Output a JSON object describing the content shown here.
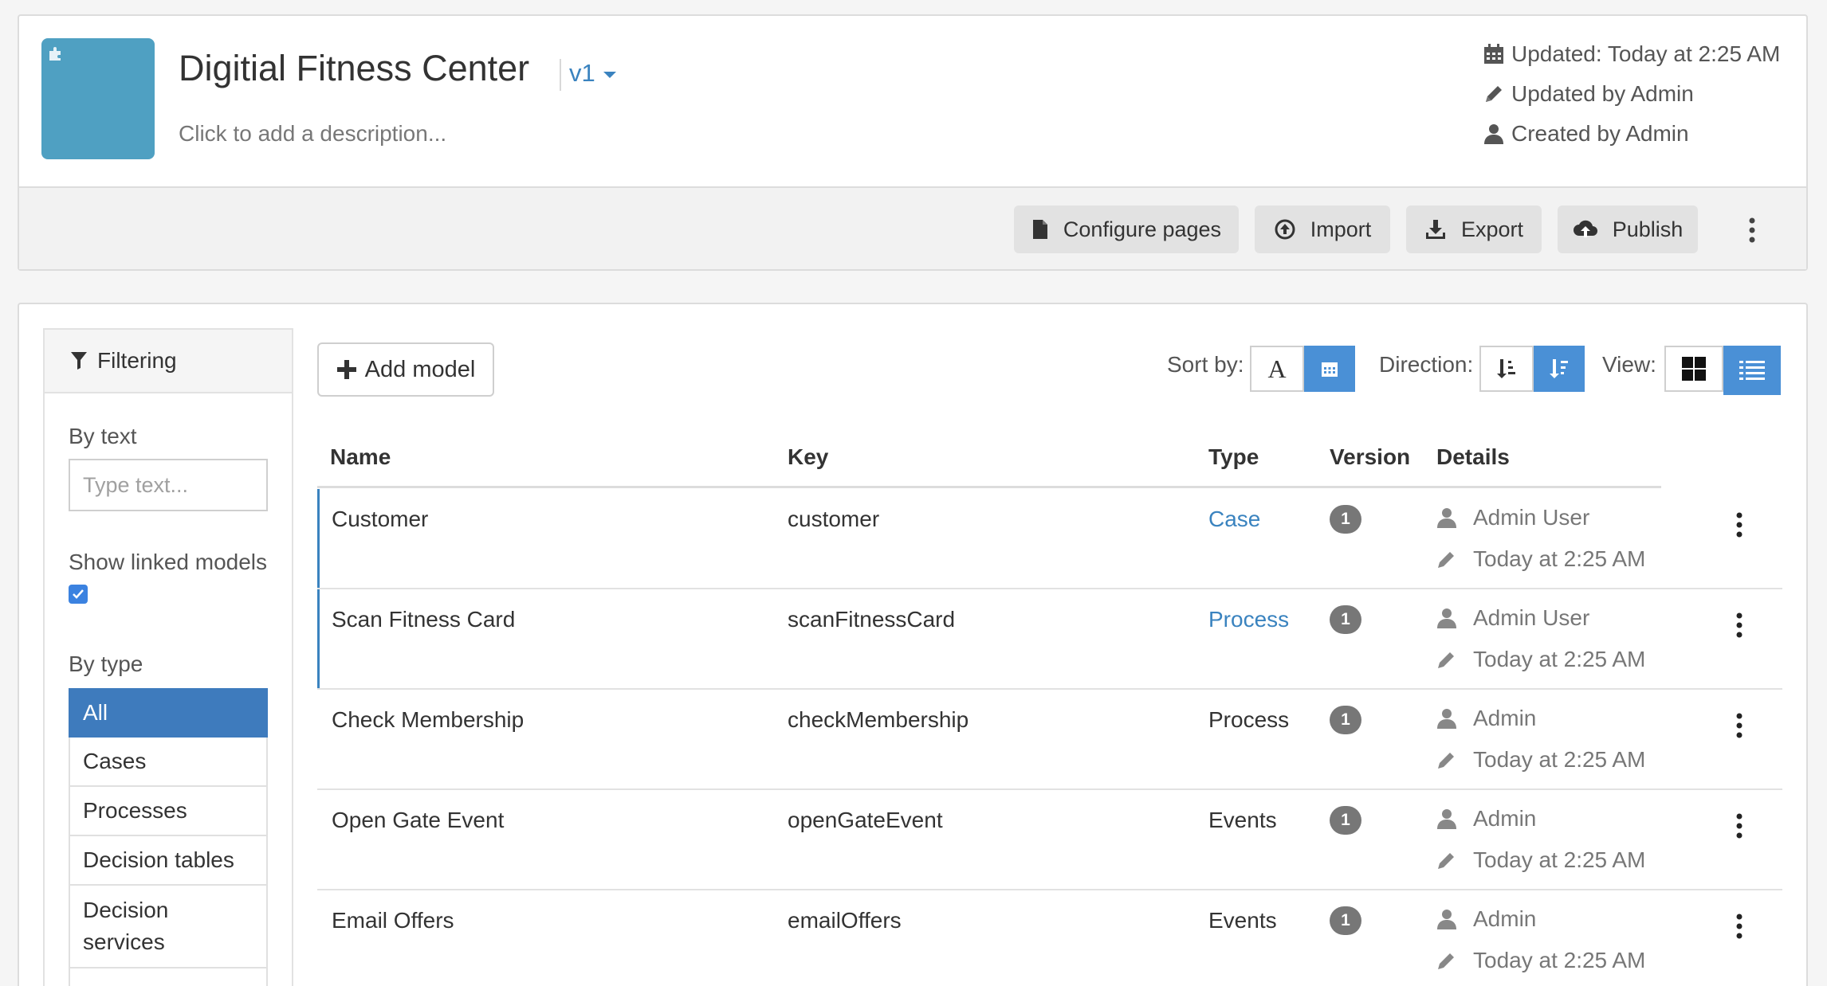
{
  "app": {
    "title": "Digitial Fitness Center",
    "version": "v1",
    "description_placeholder": "Click to add a description...",
    "updated": "Updated: Today at 2:25 AM",
    "updated_by": "Updated by Admin",
    "created_by": "Created by Admin"
  },
  "toolbar": {
    "configure_pages": "Configure pages",
    "import": "Import",
    "export": "Export",
    "publish": "Publish"
  },
  "filter": {
    "heading": "Filtering",
    "by_text": "By text",
    "text_placeholder": "Type text...",
    "show_linked": "Show linked models",
    "show_linked_checked": true,
    "by_type": "By type",
    "types": [
      "All",
      "Cases",
      "Processes",
      "Decision tables",
      "Decision services"
    ],
    "active_type": "All"
  },
  "controls": {
    "add_model": "Add model",
    "sort_by": "Sort by:",
    "sort_alpha_glyph": "A",
    "direction": "Direction:",
    "view": "View:"
  },
  "table": {
    "headers": {
      "name": "Name",
      "key": "Key",
      "type": "Type",
      "version": "Version",
      "details": "Details"
    },
    "rows": [
      {
        "name": "Customer",
        "key": "customer",
        "type": "Case",
        "version": "1",
        "user": "Admin User",
        "time": "Today at 2:25 AM"
      },
      {
        "name": "Scan Fitness Card",
        "key": "scanFitnessCard",
        "type": "Process",
        "version": "1",
        "user": "Admin User",
        "time": "Today at 2:25 AM"
      },
      {
        "name": "Check Membership",
        "key": "checkMembership",
        "type": "Process",
        "version": "1",
        "user": "Admin",
        "time": "Today at 2:25 AM"
      },
      {
        "name": "Open Gate Event",
        "key": "openGateEvent",
        "type": "Events",
        "version": "1",
        "user": "Admin",
        "time": "Today at 2:25 AM"
      },
      {
        "name": "Email Offers",
        "key": "emailOffers",
        "type": "Events",
        "version": "1",
        "user": "Admin",
        "time": "Today at 2:25 AM"
      }
    ]
  },
  "colors": {
    "accent": "#3a83bf",
    "thumbnail": "#4fa0c2",
    "active_filter": "#3e7bbd",
    "toggle_on": "#4a90d6"
  }
}
